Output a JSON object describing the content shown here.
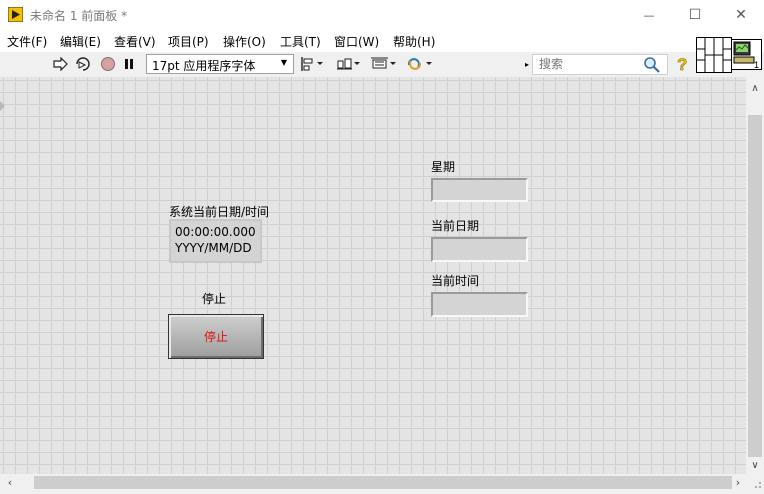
{
  "window": {
    "title": "未命名 1 前面板 *",
    "minimize_glyph": "—",
    "maximize_glyph": "☐",
    "close_glyph": "✕"
  },
  "menu": [
    {
      "label": "文件(F)"
    },
    {
      "label": "编辑(E)"
    },
    {
      "label": "查看(V)"
    },
    {
      "label": "项目(P)"
    },
    {
      "label": "操作(O)"
    },
    {
      "label": "工具(T)"
    },
    {
      "label": "窗口(W)"
    },
    {
      "label": "帮助(H)"
    }
  ],
  "toolbar": {
    "font_select": "17pt 应用程序字体",
    "search_placeholder": "搜索",
    "icons": [
      "run-arrow-icon",
      "run-continuously-icon",
      "abort-icon",
      "pause-icon",
      "align-objects-icon",
      "distribute-objects-icon",
      "resize-objects-icon",
      "reorder-icon",
      "search-icon",
      "help-icon"
    ]
  },
  "panel": {
    "datetime": {
      "label": "系统当前日期/时间",
      "time_line": "00:00:00.000",
      "date_line": "YYYY/MM/DD"
    },
    "stop": {
      "label": "停止",
      "button_text": "停止",
      "text_color": "#e01010"
    },
    "weekday": {
      "label": "星期",
      "value": ""
    },
    "current_date": {
      "label": "当前日期",
      "value": ""
    },
    "current_time": {
      "label": "当前时间",
      "value": ""
    }
  },
  "colors": {
    "panel_bg": "#e4e4e4",
    "grid_line": "#cfcfcf",
    "app_icon": "#f2c200"
  }
}
